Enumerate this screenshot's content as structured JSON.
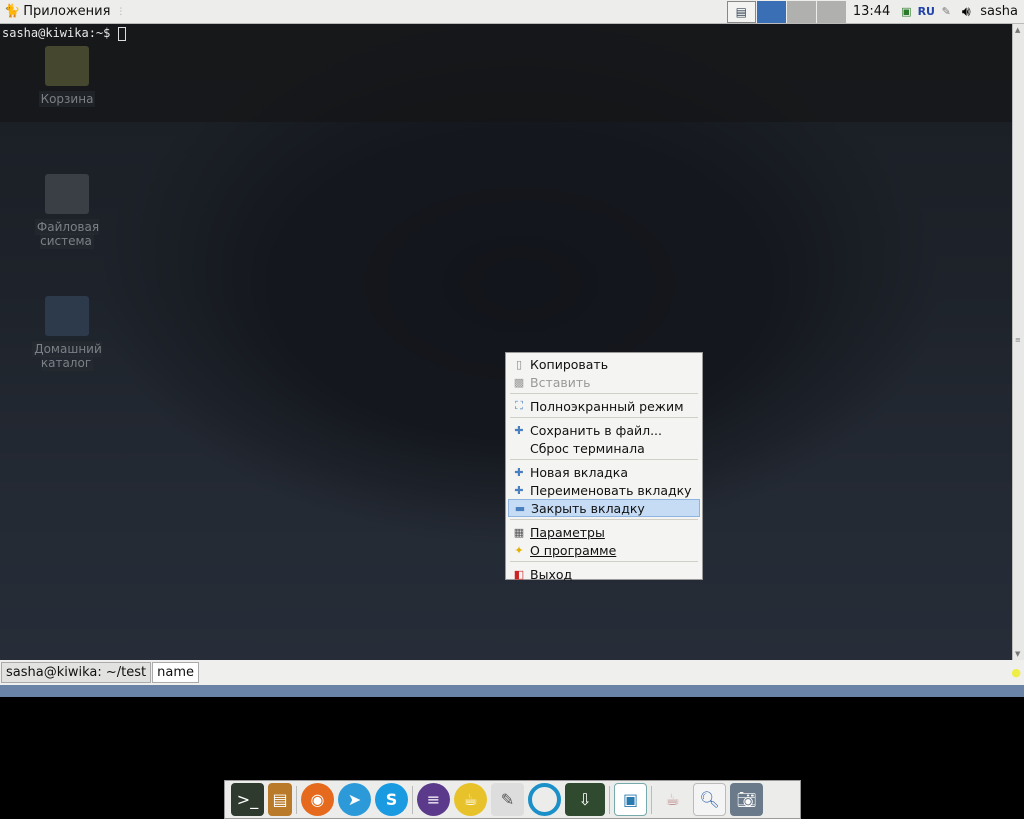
{
  "panel": {
    "apps_label": "Приложения",
    "clock": "13:44",
    "layout": "RU",
    "user": "sasha"
  },
  "terminal": {
    "prompt": "sasha@kiwika:~$ "
  },
  "desktop_icons": [
    {
      "label": "Корзина"
    },
    {
      "label": "Файловая система"
    },
    {
      "label": "Домашний каталог"
    }
  ],
  "tabs": [
    {
      "label": "sasha@kiwika: ~/test"
    },
    {
      "label": "name"
    }
  ],
  "menu": {
    "items": [
      {
        "label": "Копировать",
        "icon": "copy-icon"
      },
      {
        "label": "Вставить",
        "icon": "paste-icon",
        "disabled": true
      },
      {
        "label": "Полноэкранный режим",
        "icon": "fullscreen-icon"
      },
      {
        "label": "Сохранить в файл...",
        "icon": "plus-icon"
      },
      {
        "label": "Сброс терминала"
      },
      {
        "label": "Новая вкладка",
        "icon": "plus-icon"
      },
      {
        "label": "Переименовать вкладку",
        "icon": "plus-icon"
      },
      {
        "label": "Закрыть вкладку",
        "icon": "minus-icon",
        "highlighted": true
      },
      {
        "label": "Параметры",
        "icon": "preferences-icon"
      },
      {
        "label": "О программе",
        "icon": "star-icon"
      },
      {
        "label": "Выход",
        "icon": "exit-icon"
      }
    ]
  },
  "dock": [
    "terminal",
    "file-cabinet",
    "firefox",
    "telegram",
    "skype",
    "eclipse",
    "teapot",
    "text-editor",
    "ubuntu-circle",
    "terminal-download",
    "libreoffice-draw",
    "teacup",
    "search-document",
    "screenshot"
  ],
  "colors": {
    "accent": "#3a6fb5",
    "highlight": "#c6dcf5"
  }
}
